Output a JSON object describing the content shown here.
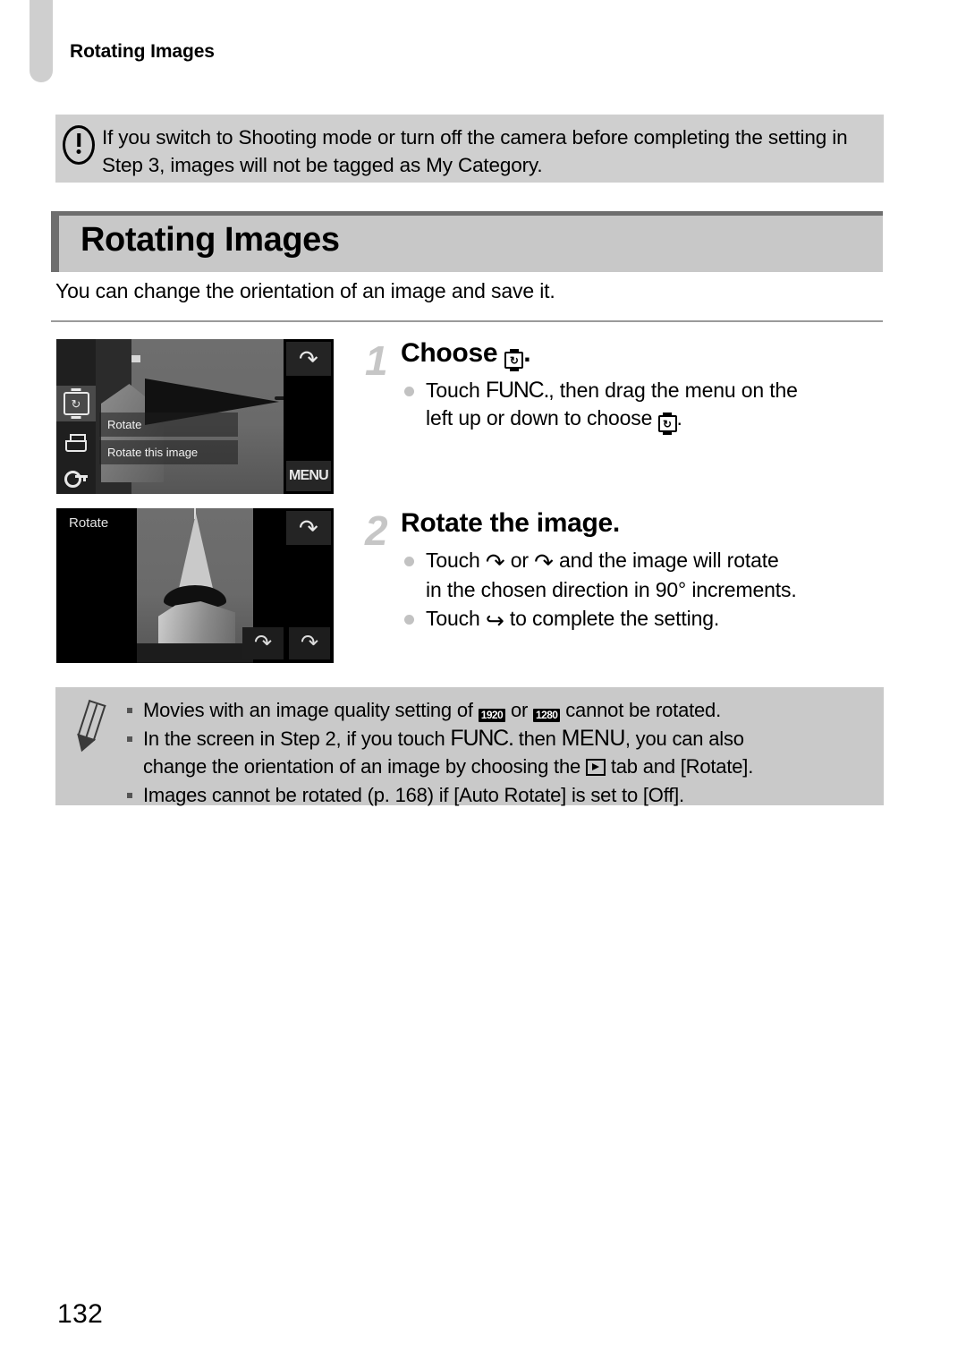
{
  "page": {
    "running_header": "Rotating Images",
    "folio": "132"
  },
  "caution": {
    "icon": "exclamation-circle-icon",
    "line1": "If you switch to Shooting mode or turn off the camera before completing the",
    "line2": "setting in Step 3, images will not be tagged as My Category."
  },
  "section": {
    "title": "Rotating Images",
    "intro": "You can change the orientation of an image and save it."
  },
  "screenshot1": {
    "menu_items": [
      "Rotate",
      "Rotate this image"
    ],
    "icons": [
      "rotate-icon",
      "print-icon",
      "protect-key-icon",
      "favorite-star-icon"
    ],
    "back_glyph": "↶",
    "menu_label": "MENU"
  },
  "screenshot2": {
    "title": "Rotate",
    "back_glyph": "↶",
    "rotate_ccw_glyph": "↶",
    "rotate_cw_glyph": "↷"
  },
  "steps": [
    {
      "number": "1",
      "heading_before": "Choose",
      "heading_icon": "rotate-icon",
      "heading_after": ".",
      "bullets": [
        {
          "parts": [
            {
              "type": "text",
              "value": "Touch "
            },
            {
              "type": "func",
              "value": "FUNC."
            },
            {
              "type": "text",
              "value": ", then drag the menu on the"
            }
          ],
          "line2_before": "left up or down to choose ",
          "line2_icon": "rotate-icon",
          "line2_after": "."
        }
      ]
    },
    {
      "number": "2",
      "heading": "Rotate the image.",
      "bullet1_line1_a": "Touch ",
      "bullet1_line1_b": " or ",
      "bullet1_line1_c": " and the image will rotate",
      "bullet1_line2": "in the chosen direction in 90° increments.",
      "bullet2_a": "Touch ",
      "bullet2_b": " to complete the setting."
    }
  ],
  "notes": {
    "icon": "pencil-note-icon",
    "items": [
      {
        "a": "Movies with an image quality setting of ",
        "badge1": "1920",
        "b": " or ",
        "badge2": "1280",
        "c": " cannot be rotated."
      },
      {
        "a": "In the screen in Step 2, if you touch ",
        "func": "FUNC.",
        "b": " then ",
        "menu": "MENU",
        "c": ", you can also",
        "line2_a": "change the orientation of an image by choosing the ",
        "line2_badge": "playback-tab-icon",
        "line2_b": " tab and [Rotate]."
      },
      {
        "a": "Images cannot be rotated (p. 168) if [Auto Rotate] is set to [Off]."
      }
    ]
  },
  "colors": {
    "band_gray": "#c8c8c8",
    "box_gray": "#c9c9c9",
    "accent_dark": "#6e6e6e",
    "step_number": "#c6c6c6"
  }
}
